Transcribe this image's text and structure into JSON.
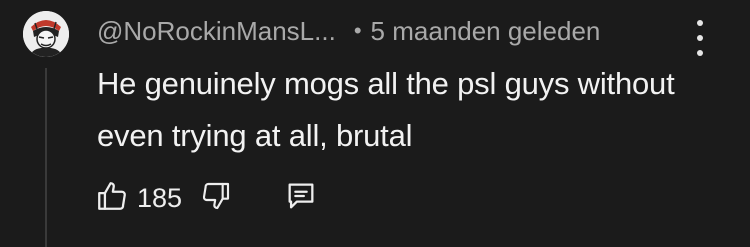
{
  "comment": {
    "author": "@NoRockinMansL...",
    "separator": "•",
    "timestamp": "5 maanden geleden",
    "text": "He genuinely mogs all the psl guys without even trying at all, brutal",
    "like_count": "185"
  },
  "icons": {
    "avatar": "avatar-image",
    "menu": "more-vertical-icon",
    "like": "thumbs-up-icon",
    "dislike": "thumbs-down-icon",
    "reply": "reply-comment-icon"
  },
  "colors": {
    "background": "#1b1b1b",
    "meta_text": "#a9a9a9",
    "body_text": "#f2f2f2",
    "thread_line": "#3a3a3a"
  }
}
